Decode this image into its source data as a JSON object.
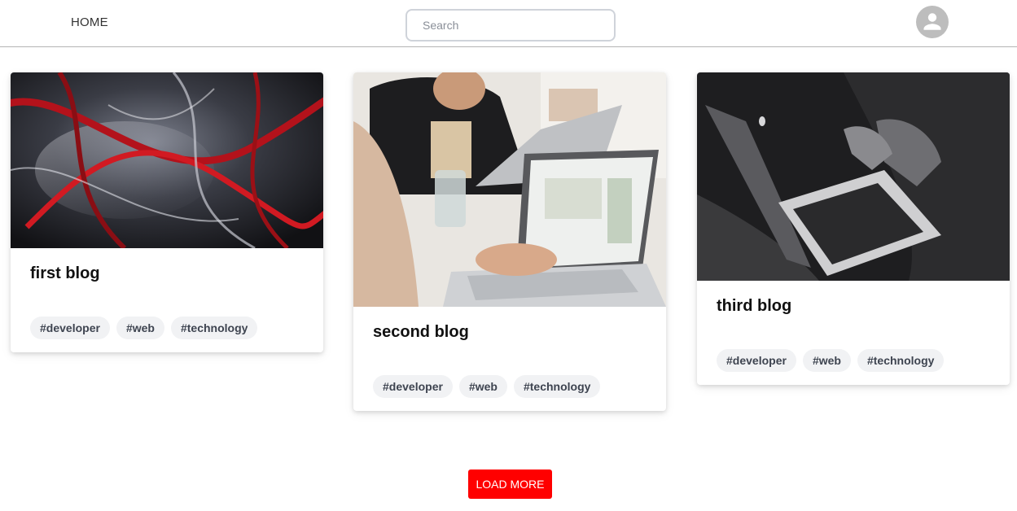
{
  "nav": {
    "home_label": "HOME",
    "search_placeholder": "Search",
    "search_value": "",
    "avatar_icon": "account-circle-icon"
  },
  "posts": [
    {
      "title": "first blog",
      "image": "abstract-red-swirl-image",
      "tags": [
        "#developer",
        "#web",
        "#technology"
      ]
    },
    {
      "title": "second blog",
      "image": "people-working-on-laptop-photo",
      "tags": [
        "#developer",
        "#web",
        "#technology"
      ]
    },
    {
      "title": "third blog",
      "image": "laptop-black-and-white-photo",
      "tags": [
        "#developer",
        "#web",
        "#technology"
      ]
    }
  ],
  "load_more_label": "LOAD MORE",
  "colors": {
    "accent": "#ff0000",
    "tag_bg": "#f1f2f4",
    "tag_text": "#3e4450",
    "avatar": "#bdbdbd"
  }
}
